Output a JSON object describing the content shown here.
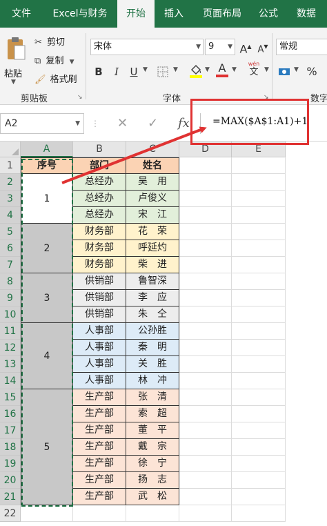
{
  "tabs": [
    {
      "label": "文件",
      "active": false
    },
    {
      "label": "Excel与财务",
      "active": false
    },
    {
      "label": "开始",
      "active": true
    },
    {
      "label": "插入",
      "active": false
    },
    {
      "label": "页面布局",
      "active": false
    },
    {
      "label": "公式",
      "active": false
    },
    {
      "label": "数据",
      "active": false
    }
  ],
  "ribbon": {
    "paste_label": "粘贴",
    "cut_label": "剪切",
    "copy_label": "复制",
    "format_painter_label": "格式刷",
    "clipboard_group": "剪贴板",
    "font_name": "宋体",
    "font_size": "9",
    "grow_font": "A",
    "shrink_font": "A",
    "bold": "B",
    "italic": "I",
    "underline": "U",
    "font_color_letter": "A",
    "phonetic_top": "wén",
    "phonetic_bottom": "文",
    "font_group": "字体",
    "number_format": "常规",
    "percent": "%",
    "number_group": "数字"
  },
  "formula_bar": {
    "name_box": "A2",
    "cancel": "✕",
    "enter": "✓",
    "fx": "fx",
    "formula": "=MAX($A$1:A1)+1"
  },
  "colors": {
    "ribbon_green": "#217346",
    "header_fill": "#fbd3b4",
    "dept_fill_1": "#e2efda",
    "dept_fill_2": "#fff2cc",
    "dept_fill_3": "#ededed",
    "dept_fill_4": "#ddebf7",
    "dept_fill_5": "#fce4d6",
    "merged_fill": "#c8c8c8",
    "annotation_red": "#e03232"
  },
  "sheet": {
    "columns": [
      "A",
      "B",
      "C",
      "D",
      "E"
    ],
    "rows": [
      "1",
      "2",
      "3",
      "4",
      "5",
      "6",
      "7",
      "8",
      "9",
      "10",
      "11",
      "12",
      "13",
      "14",
      "15",
      "16",
      "17",
      "18",
      "19",
      "20",
      "21",
      "22"
    ],
    "headers": {
      "a": "序号",
      "b": "部门",
      "c": "姓名"
    },
    "groups": [
      {
        "number": "1",
        "dept": "总经办",
        "names": [
          "吴　用",
          "卢俊义",
          "宋　江"
        ]
      },
      {
        "number": "2",
        "dept": "财务部",
        "names": [
          "花　荣",
          "呼延灼",
          "柴　进"
        ]
      },
      {
        "number": "3",
        "dept": "供销部",
        "names": [
          "鲁智深",
          "李　应",
          "朱　仝"
        ]
      },
      {
        "number": "4",
        "dept": "人事部",
        "names": [
          "公孙胜",
          "秦　明",
          "关　胜",
          "林　冲"
        ]
      },
      {
        "number": "5",
        "dept": "生产部",
        "names": [
          "张　清",
          "索　超",
          "董　平",
          "戴　宗",
          "徐　宁",
          "扬　志",
          "武　松"
        ]
      }
    ]
  }
}
